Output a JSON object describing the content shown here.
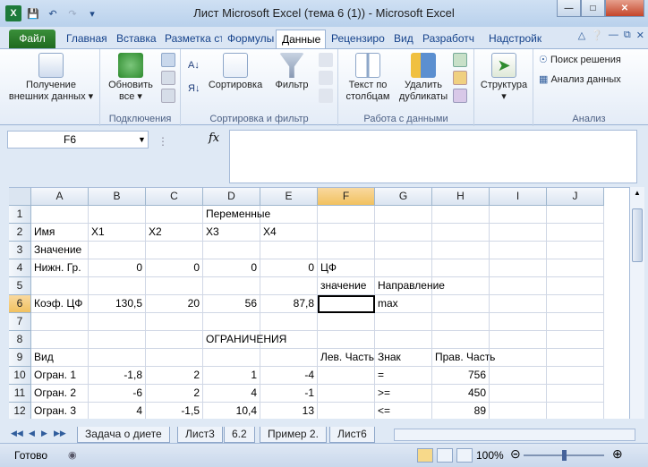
{
  "window": {
    "title": "Лист Microsoft Excel (тема 6 (1))  -  Microsoft Excel"
  },
  "tabs": [
    "Файл",
    "Главная",
    "Вставка",
    "Разметка ст",
    "Формулы",
    "Данные",
    "Рецензиро",
    "Вид",
    "Разработч",
    "Надстройк"
  ],
  "ribbon": {
    "groups": {
      "get_external": {
        "button": "Получение внешних данных"
      },
      "connections": {
        "label": "Подключения",
        "refresh": "Обновить все"
      },
      "sort_filter": {
        "label": "Сортировка и фильтр",
        "sort": "Сортировка",
        "filter": "Фильтр"
      },
      "data_tools": {
        "label": "Работа с данными",
        "text_to_cols": "Текст по столбцам",
        "remove_dupes": "Удалить дубликаты"
      },
      "outline": {
        "button": "Структура"
      },
      "analysis": {
        "label": "Анализ",
        "solver": "Поиск решения",
        "data_analysis": "Анализ данных"
      }
    }
  },
  "formula_bar": {
    "name_box": "F6",
    "fx": "fx",
    "formula": ""
  },
  "grid": {
    "columns": [
      "A",
      "B",
      "C",
      "D",
      "E",
      "F",
      "G",
      "H",
      "I",
      "J"
    ],
    "rows": [
      "1",
      "2",
      "3",
      "4",
      "5",
      "6",
      "7",
      "8",
      "9",
      "10",
      "11",
      "12"
    ],
    "cells": {
      "r1": {
        "D": "Переменные"
      },
      "r2": {
        "A": "Имя",
        "B": "X1",
        "C": "X2",
        "D": "X3",
        "E": "X4"
      },
      "r3": {
        "A": "Значение"
      },
      "r4": {
        "A": "Нижн. Гр.",
        "B": "0",
        "C": "0",
        "D": "0",
        "E": "0",
        "F": "ЦФ"
      },
      "r5": {
        "F": "значение",
        "G": "Направление"
      },
      "r6": {
        "A": "Коэф. ЦФ",
        "B": "130,5",
        "C": "20",
        "D": "56",
        "E": "87,8",
        "G": "max"
      },
      "r8": {
        "D": "ОГРАНИЧЕНИЯ"
      },
      "r9": {
        "A": "Вид",
        "F": "Лев. Часть",
        "G": "Знак",
        "H": "Прав. Часть"
      },
      "r10": {
        "A": "Огран. 1",
        "B": "-1,8",
        "C": "2",
        "D": "1",
        "E": "-4",
        "G": "=",
        "H": "756"
      },
      "r11": {
        "A": "Огран. 2",
        "B": "-6",
        "C": "2",
        "D": "4",
        "E": "-1",
        "G": ">=",
        "H": "450"
      },
      "r12": {
        "A": "Огран. 3",
        "B": "4",
        "C": "-1,5",
        "D": "10,4",
        "E": "13",
        "G": "<=",
        "H": "89"
      }
    }
  },
  "sheets": [
    "Задача о диете",
    "Лист3",
    "6.2",
    "Пример 2.",
    "Лист6"
  ],
  "status": {
    "ready": "Готово",
    "zoom": "100%"
  }
}
